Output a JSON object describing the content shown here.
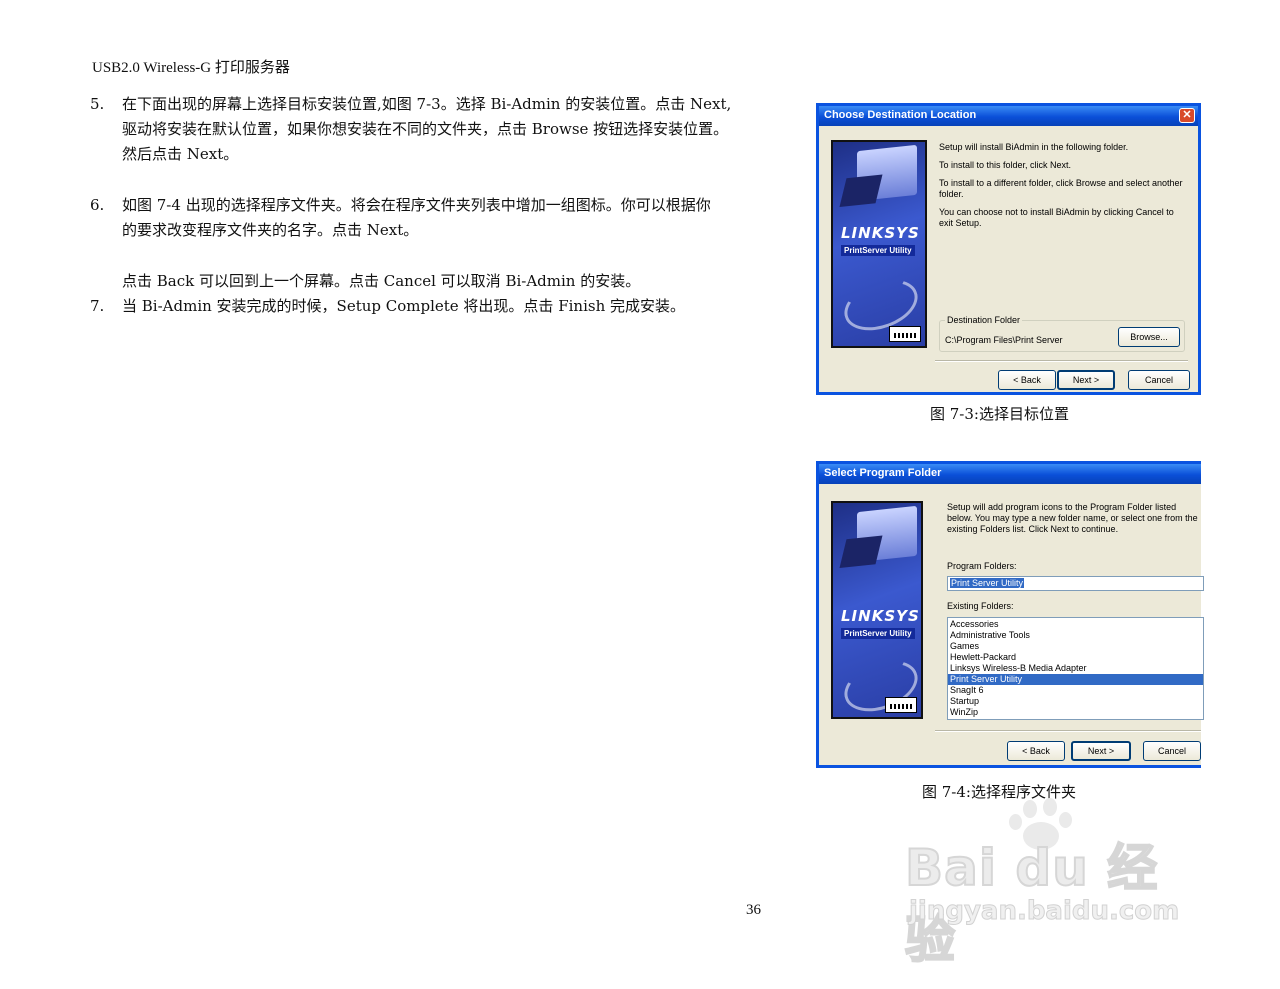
{
  "header": "USB2.0 Wireless-G 打印服务器",
  "steps": [
    {
      "num": "5.",
      "text": "在下面出现的屏幕上选择目标安装位置,如图 7-3。选择 Bi-Admin 的安装位置。点击 Next,\n驱动将安装在默认位置，如果你想安装在不同的文件夹，点击 Browse 按钮选择安装位置。\n然后点击 Next。"
    },
    {
      "num": "6.",
      "text": "如图 7-4 出现的选择程序文件夹。将会在程序文件夹列表中增加一组图标。你可以根据你\n的要求改变程序文件夹的名字。点击 Next。"
    },
    {
      "num": "",
      "text": "点击 Back 可以回到上一个屏幕。点击 Cancel 可以取消 Bi-Admin 的安装。"
    },
    {
      "num": "7.",
      "text": "当 Bi-Admin 安装完成的时候，Setup Complete 将出现。点击 Finish 完成安装。"
    }
  ],
  "figure1": {
    "title": "Choose Destination Location",
    "close_glyph": "✕",
    "brand": "LINKSYS",
    "brand_sub": "PrintServer Utility",
    "paragraphs": [
      "Setup will install BiAdmin in the following folder.",
      "To install to this folder, click Next.",
      "To install to a different folder, click Browse and select another folder.",
      "You can choose not to install BiAdmin by clicking Cancel to exit Setup."
    ],
    "dest_folder_label": "Destination Folder",
    "dest_folder_path": "C:\\Program Files\\Print Server",
    "browse_label": "Browse...",
    "back_label": "< Back",
    "next_label": "Next >",
    "cancel_label": "Cancel",
    "caption": "图 7-3:选择目标位置"
  },
  "figure2": {
    "title": "Select Program Folder",
    "brand": "LINKSYS",
    "brand_sub": "PrintServer Utility",
    "intro": "Setup will add program icons to the Program Folder listed below. You may type a new folder name, or select one from the existing Folders list.  Click Next to continue.",
    "program_folders_label": "Program Folders:",
    "program_folder_value": "Print Server Utility",
    "existing_folders_label": "Existing Folders:",
    "folders": [
      "Accessories",
      "Administrative Tools",
      "Games",
      "Hewlett-Packard",
      "Linksys Wireless-B Media Adapter",
      "Print Server Utility",
      "SnagIt 6",
      "Startup",
      "WinZip"
    ],
    "selected_folder_index": 5,
    "back_label": "< Back",
    "next_label": "Next >",
    "cancel_label": "Cancel",
    "caption": "图 7-4:选择程序文件夹"
  },
  "page_number": "36",
  "watermark": {
    "brand": "Bai du 经验",
    "url": "jingyan.baidu.com"
  }
}
